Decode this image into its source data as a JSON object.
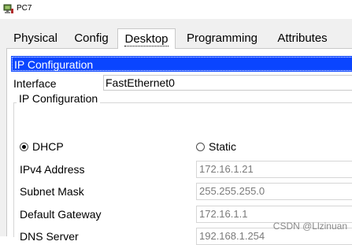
{
  "window": {
    "title": "PC7",
    "icon": "pc-icon"
  },
  "tabs": [
    {
      "label": "Physical"
    },
    {
      "label": "Config"
    },
    {
      "label": "Desktop",
      "active": true
    },
    {
      "label": "Programming"
    },
    {
      "label": "Attributes"
    }
  ],
  "panel": {
    "header": "IP Configuration",
    "interface_label": "Interface",
    "interface_value": "FastEthernet0",
    "group_title": "IP Configuration",
    "dhcp_label": "DHCP",
    "dhcp_selected": true,
    "static_label": "Static",
    "fields": [
      {
        "label": "IPv4 Address",
        "value": "172.16.1.21"
      },
      {
        "label": "Subnet Mask",
        "value": "255.255.255.0"
      },
      {
        "label": "Default Gateway",
        "value": "172.16.1.1"
      },
      {
        "label": "DNS Server",
        "value": "192.168.1.254"
      }
    ]
  },
  "watermark": "CSDN @Llzinuan",
  "colors": {
    "header_bar": "#0a45ff",
    "background": "#f0f0f0"
  }
}
